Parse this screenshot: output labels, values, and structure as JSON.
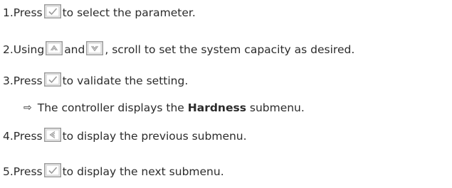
{
  "steps": [
    {
      "num": "1.",
      "before": " Press",
      "after": "to select the parameter."
    },
    {
      "num": "2.",
      "before": " Using",
      "mid": "and",
      "after": ", scroll to set the system capacity as desired."
    },
    {
      "num": "3.",
      "before": " Press",
      "after": "to validate the setting."
    },
    {
      "num": "4.",
      "before": " Press",
      "after": "to display the previous submenu."
    },
    {
      "num": "5.",
      "before": " Press",
      "after": "to display the next submenu."
    }
  ],
  "result": {
    "arrow": "⇨",
    "text_before": "The controller displays the ",
    "bold": "Hardness",
    "text_after": " submenu."
  },
  "icons": {
    "check": "check-key-icon",
    "up": "up-key-icon",
    "down": "down-key-icon",
    "left": "left-key-icon"
  }
}
